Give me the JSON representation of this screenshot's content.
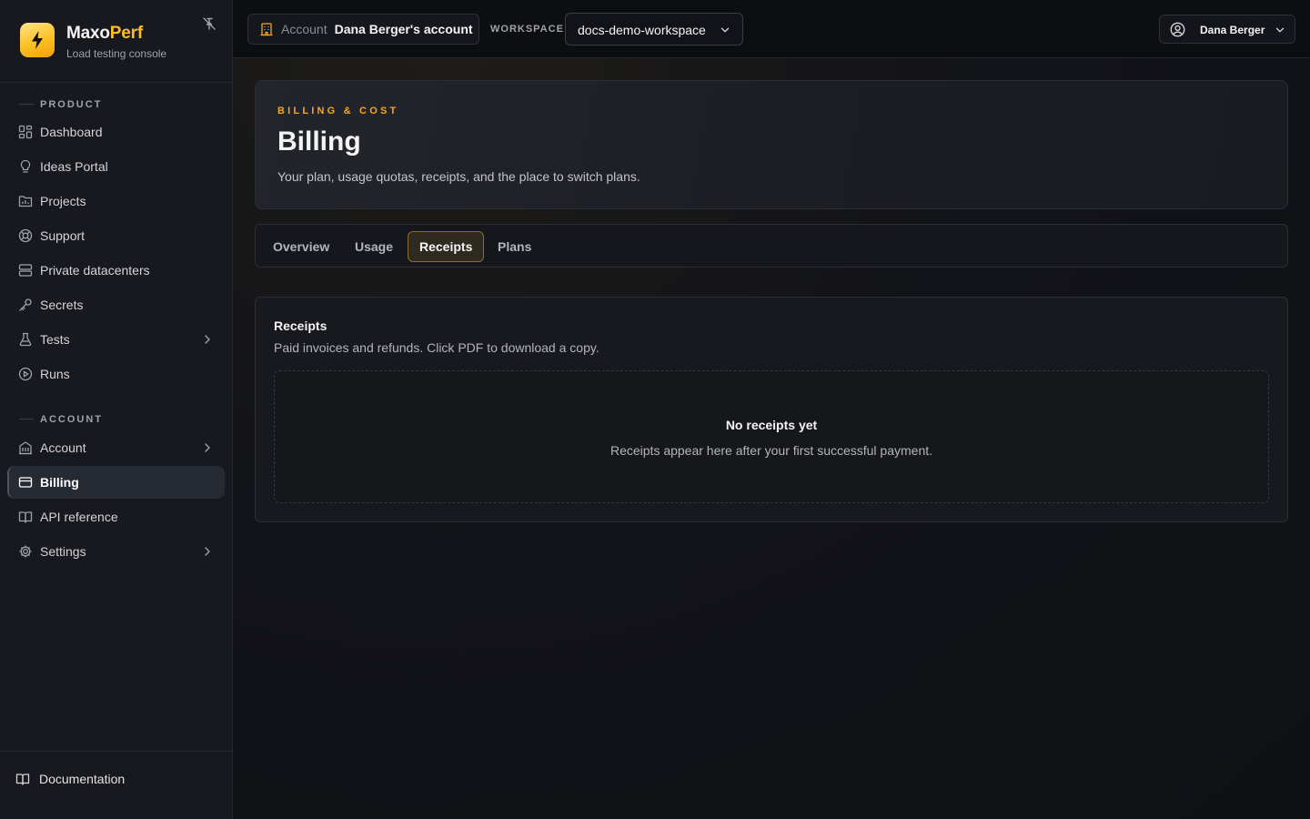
{
  "brand": {
    "name_main": "Maxo",
    "name_accent": "Perf",
    "subtitle": "Load testing console",
    "accent_color": "#fbbf24"
  },
  "sidebar": {
    "sections": [
      {
        "label": "PRODUCT",
        "items": [
          {
            "label": "Dashboard",
            "icon": "dashboard-icon"
          },
          {
            "label": "Ideas Portal",
            "icon": "lightbulb-icon"
          },
          {
            "label": "Projects",
            "icon": "folder-icon"
          },
          {
            "label": "Support",
            "icon": "lifebuoy-icon"
          },
          {
            "label": "Private datacenters",
            "icon": "server-icon"
          },
          {
            "label": "Secrets",
            "icon": "key-icon"
          },
          {
            "label": "Tests",
            "icon": "flask-icon",
            "has_children": true
          },
          {
            "label": "Runs",
            "icon": "play-circle-icon"
          }
        ]
      },
      {
        "label": "ACCOUNT",
        "items": [
          {
            "label": "Account",
            "icon": "building-icon",
            "has_children": true
          },
          {
            "label": "Billing",
            "icon": "credit-card-icon",
            "active": true
          },
          {
            "label": "API reference",
            "icon": "book-icon"
          },
          {
            "label": "Settings",
            "icon": "gear-icon",
            "has_children": true
          }
        ]
      }
    ],
    "footer": {
      "label": "Documentation",
      "icon": "book-icon"
    }
  },
  "topbar": {
    "account_label": "Account",
    "account_name": "Dana Berger's account",
    "workspace_label": "WORKSPACE",
    "workspace_value": "docs-demo-workspace",
    "user_name": "Dana Berger"
  },
  "page": {
    "eyebrow": "BILLING & COST",
    "title": "Billing",
    "description": "Your plan, usage quotas, receipts, and the place to switch plans.",
    "tabs": [
      {
        "label": "Overview"
      },
      {
        "label": "Usage"
      },
      {
        "label": "Receipts",
        "active": true
      },
      {
        "label": "Plans"
      }
    ],
    "receipts": {
      "title": "Receipts",
      "description": "Paid invoices and refunds. Click PDF to download a copy.",
      "empty_title": "No receipts yet",
      "empty_description": "Receipts appear here after your first successful payment."
    }
  }
}
